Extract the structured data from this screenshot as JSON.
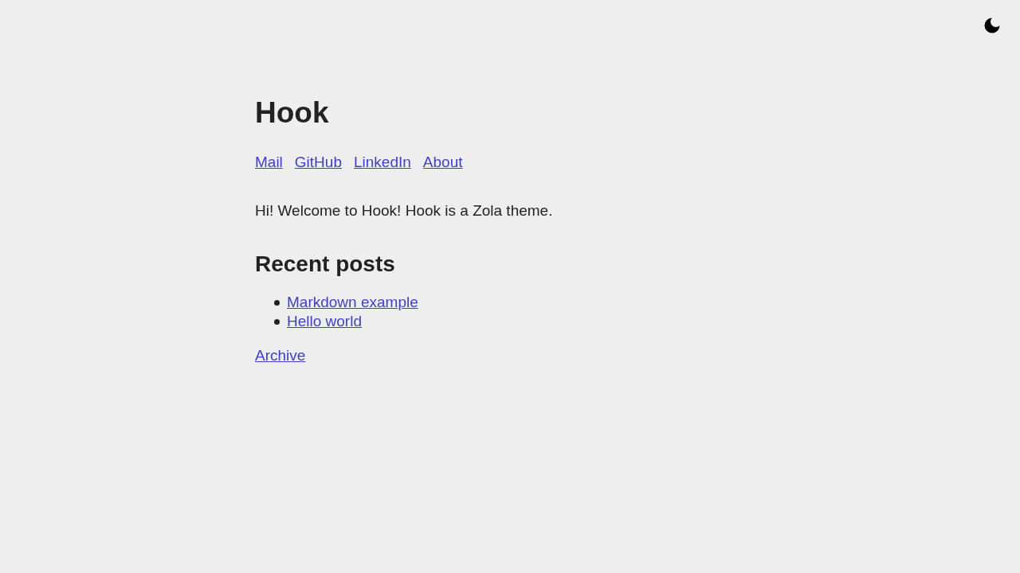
{
  "title": "Hook",
  "nav": [
    "Mail",
    "GitHub",
    "LinkedIn",
    "About"
  ],
  "intro": "Hi! Welcome to Hook! Hook is a Zola theme.",
  "recent_posts": {
    "heading": "Recent posts",
    "items": [
      "Markdown example",
      "Hello world"
    ]
  },
  "archive_link": "Archive"
}
